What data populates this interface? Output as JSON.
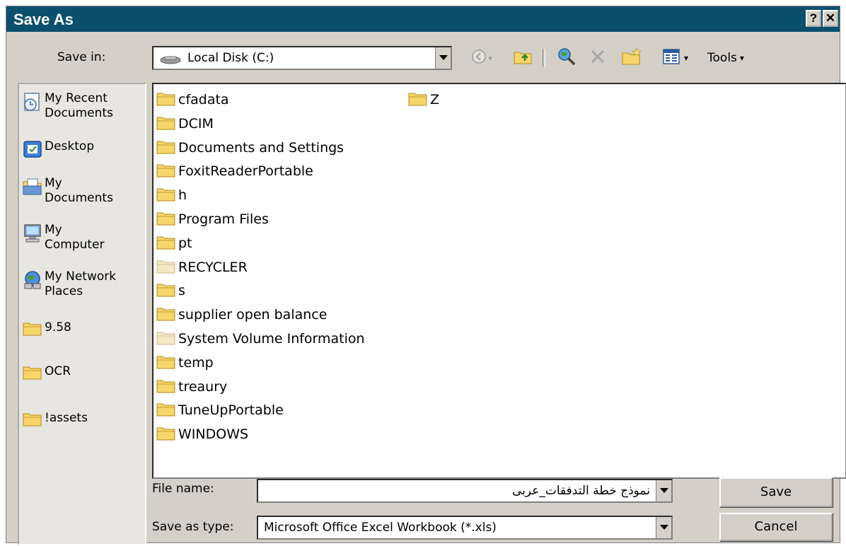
{
  "window": {
    "title": "Save As",
    "help_label": "?",
    "close_label": "✕"
  },
  "toolbar": {
    "save_in_label": "Save in:",
    "location": "Local Disk (C:)",
    "tools_label": "Tools",
    "icons": [
      "back-icon",
      "up-folder-icon",
      "search-web-icon",
      "delete-icon",
      "new-folder-icon",
      "views-icon"
    ]
  },
  "places": [
    {
      "label": "My Recent\nDocuments",
      "icon": "recent-documents-icon"
    },
    {
      "label": "Desktop",
      "icon": "desktop-icon"
    },
    {
      "label": "My\nDocuments",
      "icon": "my-documents-icon"
    },
    {
      "label": "My\nComputer",
      "icon": "my-computer-icon"
    },
    {
      "label": "My Network\nPlaces",
      "icon": "network-places-icon"
    },
    {
      "label": "9.58",
      "icon": "folder-icon"
    },
    {
      "label": "OCR",
      "icon": "folder-icon"
    },
    {
      "label": "!assets",
      "icon": "folder-icon"
    }
  ],
  "files": [
    {
      "name": "cfadata",
      "hidden": false
    },
    {
      "name": "DCIM",
      "hidden": false
    },
    {
      "name": "Documents and Settings",
      "hidden": false
    },
    {
      "name": "FoxitReaderPortable",
      "hidden": false
    },
    {
      "name": "h",
      "hidden": false
    },
    {
      "name": "Program Files",
      "hidden": false
    },
    {
      "name": "pt",
      "hidden": false
    },
    {
      "name": "RECYCLER",
      "hidden": true
    },
    {
      "name": "s",
      "hidden": false
    },
    {
      "name": "supplier open balance",
      "hidden": false
    },
    {
      "name": "System Volume Information",
      "hidden": true
    },
    {
      "name": "temp",
      "hidden": false
    },
    {
      "name": "treaury",
      "hidden": false
    },
    {
      "name": "TuneUpPortable",
      "hidden": false
    },
    {
      "name": "WINDOWS",
      "hidden": false
    },
    {
      "name": "Z",
      "hidden": false
    }
  ],
  "form": {
    "file_name_label": "File name:",
    "file_name_value": "نموذج خطة التدفقات_عربى",
    "save_type_label": "Save as type:",
    "save_type_value": "Microsoft Office Excel Workbook (*.xls)",
    "save_button": "Save",
    "cancel_button": "Cancel"
  },
  "colors": {
    "titlebar": "#0a4f6e",
    "face": "#d4d0c8",
    "folder": "#f6d66b",
    "folder_hidden": "#f3e9c4"
  }
}
